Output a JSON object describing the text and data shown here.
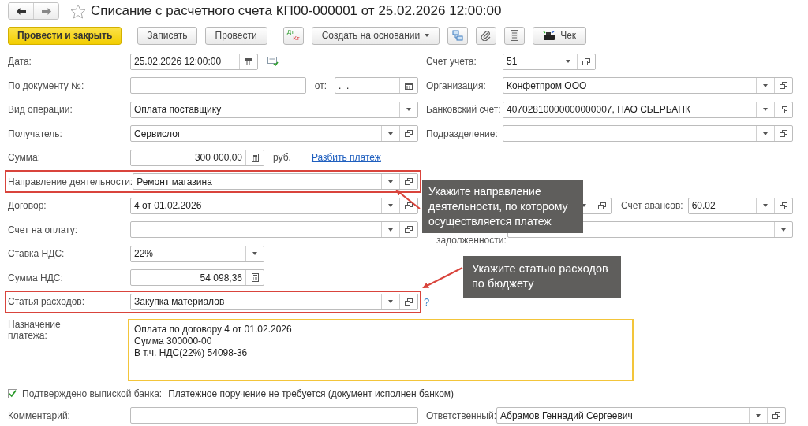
{
  "window": {
    "title": "Списание с расчетного счета КП00-000001 от 25.02.2026 12:00:00",
    "favorite": false
  },
  "toolbar": [
    {
      "kind": "primary",
      "label": "Провести и закрыть"
    },
    {
      "kind": "button",
      "label": "Записать"
    },
    {
      "kind": "button",
      "label": "Провести"
    },
    {
      "kind": "dtkt",
      "top": "Дт",
      "bottom": "Кт"
    },
    {
      "kind": "menu",
      "label": "Создать на основании"
    },
    {
      "kind": "structure"
    },
    {
      "kind": "clip"
    },
    {
      "kind": "list"
    },
    {
      "kind": "receipt",
      "label": "Чек"
    }
  ],
  "rows": [
    {
      "highlighted": false,
      "left": [
        {
          "kind": "label",
          "text": "Дата:"
        },
        {
          "kind": "date",
          "value": "25.02.2026 12:00:00"
        },
        {
          "kind": "icon"
        }
      ],
      "right": [
        {
          "kind": "label",
          "text": "Счет учета:"
        },
        {
          "kind": "short-choice",
          "value": "51"
        }
      ]
    },
    {
      "highlighted": false,
      "left": [
        {
          "kind": "label",
          "text": "По документу №:"
        },
        {
          "kind": "input"
        },
        {
          "kind": "text",
          "text": "от:"
        },
        {
          "kind": "date-short",
          "value": ".  ."
        }
      ],
      "right": [
        {
          "kind": "label",
          "text": "Организация:"
        },
        {
          "kind": "choice",
          "value": "Конфетпром ООО"
        }
      ]
    },
    {
      "highlighted": false,
      "left": [
        {
          "kind": "label",
          "text": "Вид операции:"
        },
        {
          "kind": "select",
          "value": "Оплата поставщику"
        }
      ],
      "right": [
        {
          "kind": "label",
          "text": "Банковский счет:"
        },
        {
          "kind": "choice",
          "value": "40702810000000000007, ПАО СБЕРБАНК"
        }
      ]
    },
    {
      "highlighted": false,
      "left": [
        {
          "kind": "label",
          "text": "Получатель:"
        },
        {
          "kind": "choice",
          "value": "Сервислог"
        }
      ],
      "right": [
        {
          "kind": "label",
          "text": "Подразделение:"
        },
        {
          "kind": "choice"
        }
      ]
    },
    {
      "highlighted": false,
      "left": [
        {
          "kind": "label",
          "text": "Сумма:"
        },
        {
          "kind": "calc",
          "value": "300 000,00"
        },
        {
          "kind": "text",
          "text": "руб."
        },
        {
          "kind": "link",
          "text": "Разбить платеж"
        }
      ],
      "right": []
    },
    {
      "highlighted": true,
      "left": [
        {
          "kind": "label",
          "text": "Направление деятельности:"
        },
        {
          "kind": "choice",
          "value": "Ремонт магазина"
        }
      ],
      "right": []
    },
    {
      "highlighted": false,
      "left": [
        {
          "kind": "label",
          "text": "Договор:"
        },
        {
          "kind": "choice",
          "value": "4 от 01.02.2026"
        }
      ],
      "right": [
        {
          "kind": "covered-choice"
        },
        {
          "kind": "label",
          "text": "Счет авансов:"
        },
        {
          "kind": "choice",
          "value": "60.02"
        }
      ]
    },
    {
      "highlighted": false,
      "left": [
        {
          "kind": "label",
          "text": "Счет на оплату:"
        },
        {
          "kind": "choice"
        }
      ],
      "right": [
        {
          "kind": "sublabel",
          "text": "задолженности:"
        },
        {
          "kind": "select"
        }
      ]
    },
    {
      "highlighted": false,
      "left": [
        {
          "kind": "label",
          "text": "Ставка НДС:"
        },
        {
          "kind": "short-select",
          "value": "22%"
        }
      ],
      "right": []
    },
    {
      "highlighted": false,
      "left": [
        {
          "kind": "label",
          "text": "Сумма НДС:"
        },
        {
          "kind": "calc",
          "value": "54 098,36"
        }
      ],
      "right": []
    },
    {
      "highlighted": true,
      "left": [
        {
          "kind": "label",
          "text": "Статья расходов:"
        },
        {
          "kind": "choice",
          "value": "Закупка материалов"
        }
      ],
      "right": [
        {
          "kind": "help",
          "text": "?"
        }
      ]
    }
  ],
  "purpose": {
    "label": "Назначение платежа:",
    "value": "Оплата по договору 4 от 01.02.2026\nСумма 300000-00\nВ т.ч. НДС(22%) 54098-36"
  },
  "confirmation": {
    "label": "Подтверждено выпиской банка:",
    "checked": true,
    "note": "Платежное поручение не требуется (документ исполнен банком)"
  },
  "comment": {
    "label": "Комментарий:",
    "responsible_label": "Ответственный:",
    "responsible": "Абрамов Геннадий Сергеевич"
  },
  "callouts": [
    {
      "text": "Укажите направление деятельности, по которому осуществляется платеж"
    },
    {
      "text": "Укажите статью расходов по бюджету"
    }
  ]
}
